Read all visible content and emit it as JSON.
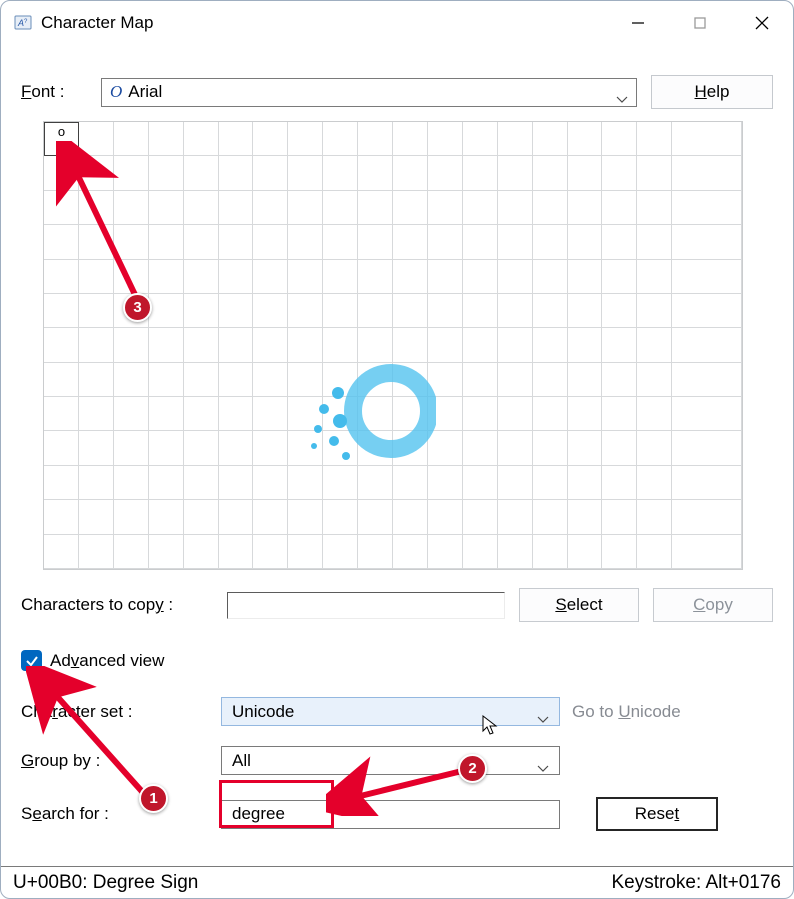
{
  "titlebar": {
    "title": "Character Map"
  },
  "font_row": {
    "label": "Font :",
    "italic_glyph": "O",
    "value": "Arial",
    "help_label": "Help"
  },
  "grid": {
    "selected_char": "o"
  },
  "copy_row": {
    "label": "Characters to copy :",
    "select_label": "Select",
    "copy_label": "Copy"
  },
  "advanced": {
    "label": "Advanced view"
  },
  "charset_row": {
    "label": "Character set :",
    "value": "Unicode",
    "goto_label": "Go to Unicode"
  },
  "groupby_row": {
    "label": "Group by :",
    "value": "All"
  },
  "search_row": {
    "label": "Search for :",
    "value": "degree",
    "reset_label": "Reset"
  },
  "statusbar": {
    "left": "U+00B0: Degree Sign",
    "right": "Keystroke: Alt+0176"
  },
  "annotations": {
    "badge1": "1",
    "badge2": "2",
    "badge3": "3"
  }
}
